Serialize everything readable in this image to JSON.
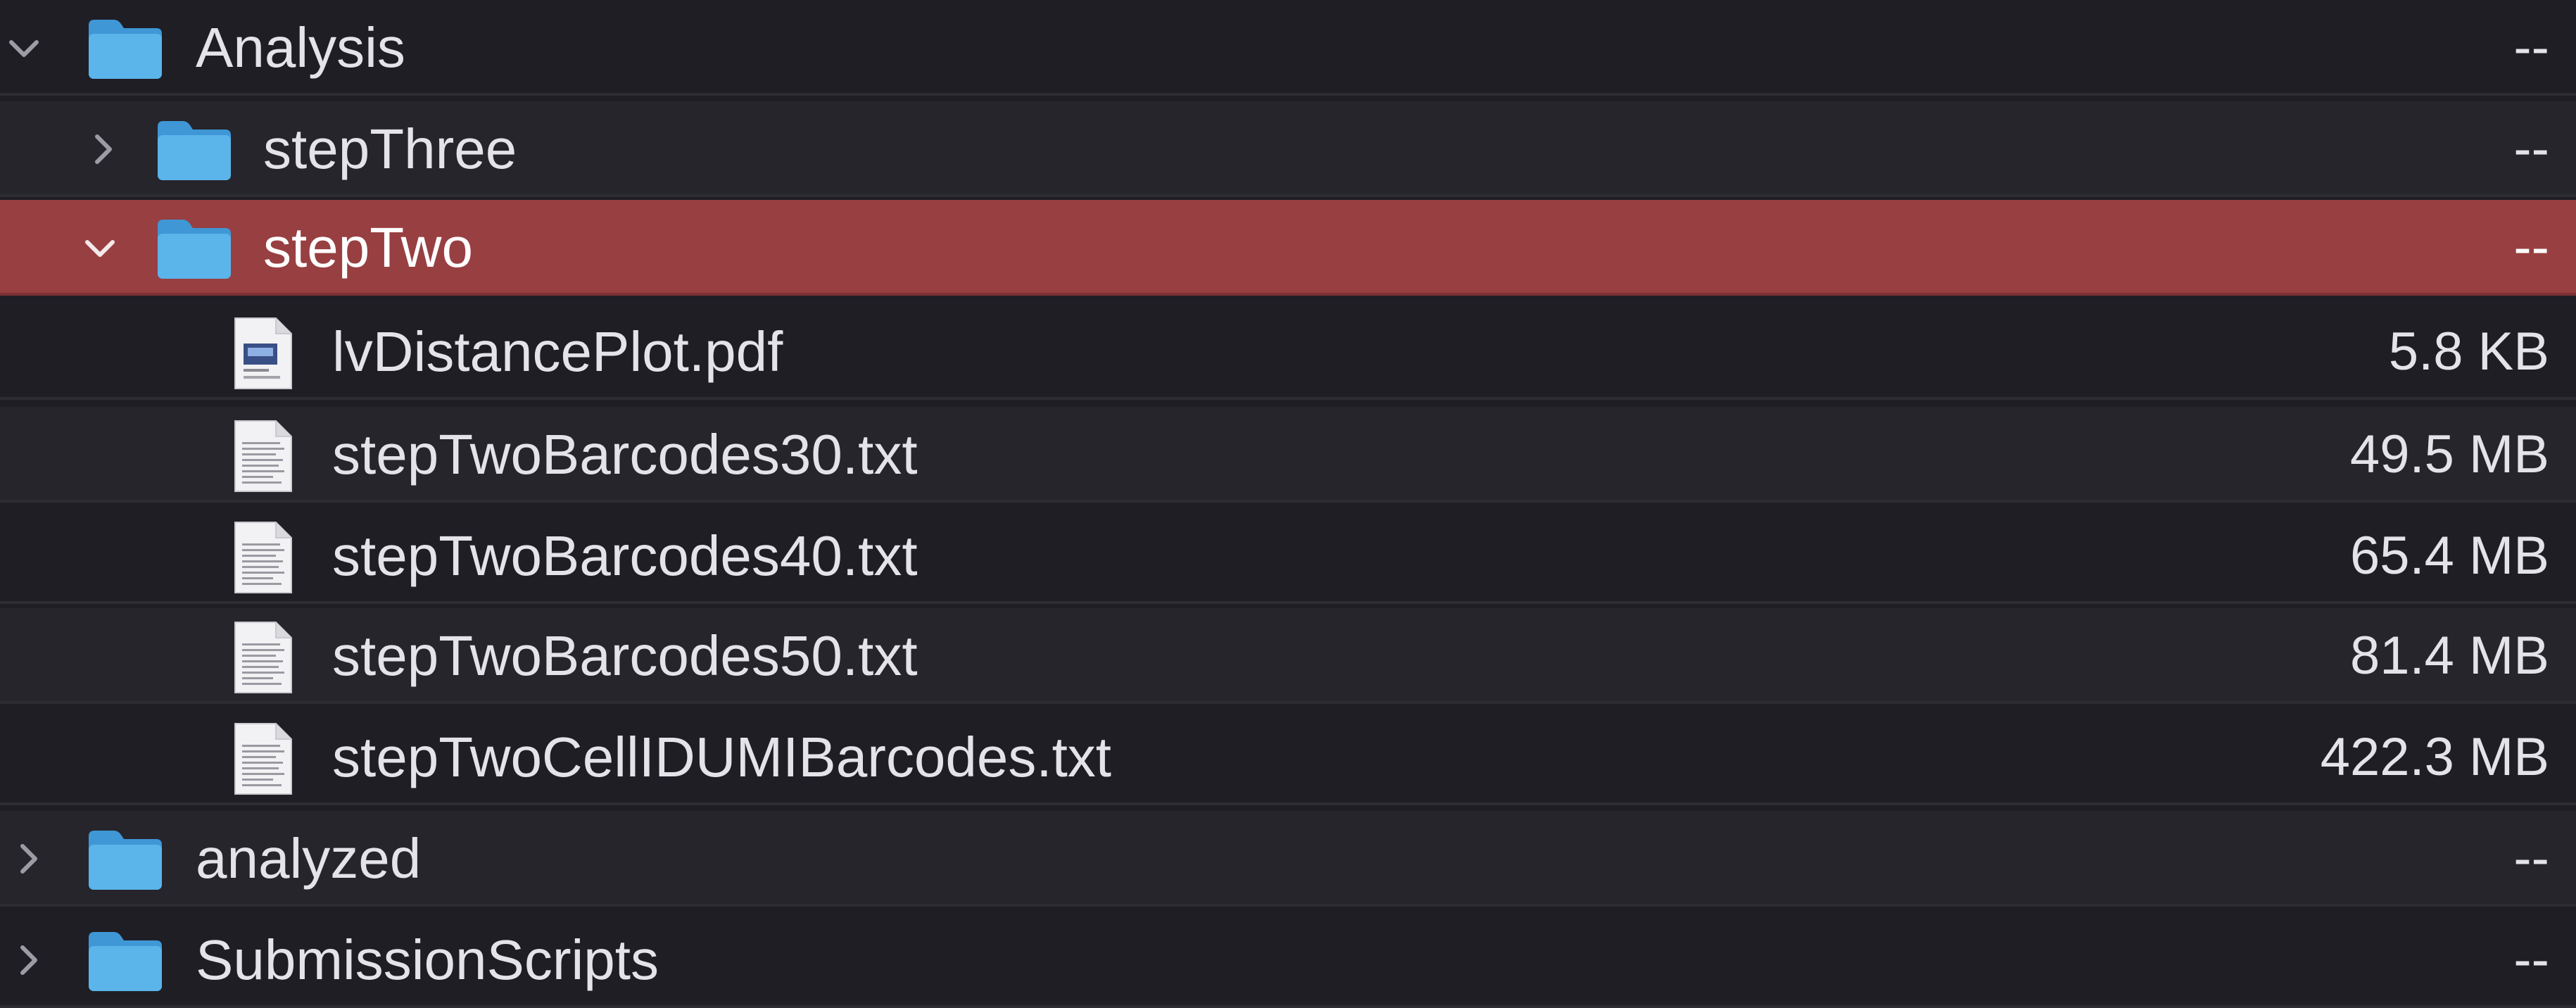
{
  "colors": {
    "background": "#1f1e25",
    "row_alt": "#26252b",
    "selection": "#983f42",
    "folder": "#5bb4ea",
    "text": "#e4e3e8"
  },
  "rows": [
    {
      "name": "Analysis",
      "size": "--",
      "kind": "folder",
      "icon": "folder-icon",
      "disclosure": "expanded",
      "selected": false
    },
    {
      "name": "stepThree",
      "size": "--",
      "kind": "folder",
      "icon": "folder-icon",
      "disclosure": "collapsed",
      "selected": false
    },
    {
      "name": "stepTwo",
      "size": "--",
      "kind": "folder",
      "icon": "folder-icon",
      "disclosure": "expanded",
      "selected": true
    },
    {
      "name": "lvDistancePlot.pdf",
      "size": "5.8 KB",
      "kind": "pdf",
      "icon": "pdf-file-icon",
      "disclosure": "none",
      "selected": false
    },
    {
      "name": "stepTwoBarcodes30.txt",
      "size": "49.5 MB",
      "kind": "text",
      "icon": "text-file-icon",
      "disclosure": "none",
      "selected": false
    },
    {
      "name": "stepTwoBarcodes40.txt",
      "size": "65.4 MB",
      "kind": "text",
      "icon": "text-file-icon",
      "disclosure": "none",
      "selected": false
    },
    {
      "name": "stepTwoBarcodes50.txt",
      "size": "81.4 MB",
      "kind": "text",
      "icon": "text-file-icon",
      "disclosure": "none",
      "selected": false
    },
    {
      "name": "stepTwoCellIDUMIBarcodes.txt",
      "size": "422.3 MB",
      "kind": "text",
      "icon": "text-file-icon",
      "disclosure": "none",
      "selected": false
    },
    {
      "name": "analyzed",
      "size": "--",
      "kind": "folder",
      "icon": "folder-icon",
      "disclosure": "collapsed",
      "selected": false
    },
    {
      "name": "SubmissionScripts",
      "size": "--",
      "kind": "folder",
      "icon": "folder-icon",
      "disclosure": "collapsed",
      "selected": false
    }
  ]
}
